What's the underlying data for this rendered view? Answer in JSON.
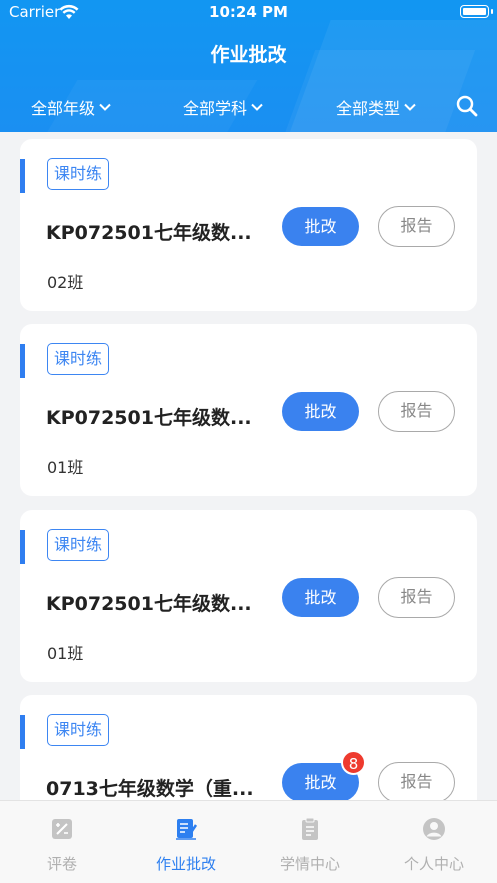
{
  "status_bar": {
    "carrier": "Carrier",
    "time": "10:24 PM"
  },
  "header": {
    "title": "作业批改",
    "filters": [
      {
        "label": "全部年级"
      },
      {
        "label": "全部学科"
      },
      {
        "label": "全部类型"
      }
    ],
    "search_icon": "search-icon"
  },
  "cards": [
    {
      "tag": "课时练",
      "title": "KP072501七年级数...",
      "class": "02班",
      "grade_label": "批改",
      "report_label": "报告"
    },
    {
      "tag": "课时练",
      "title": "KP072501七年级数...",
      "class": "01班",
      "grade_label": "批改",
      "report_label": "报告"
    },
    {
      "tag": "课时练",
      "title": "KP072501七年级数...",
      "class": "01班",
      "grade_label": "批改",
      "report_label": "报告"
    },
    {
      "tag": "课时练",
      "title": "0713七年级数学（重...",
      "class": "",
      "grade_label": "批改",
      "report_label": "报告",
      "badge": "8"
    }
  ],
  "tabbar": {
    "tabs": [
      {
        "label": "评卷",
        "icon": "exam-paper-icon"
      },
      {
        "label": "作业批改",
        "icon": "homework-edit-icon",
        "active": true
      },
      {
        "label": "学情中心",
        "icon": "clipboard-icon"
      },
      {
        "label": "个人中心",
        "icon": "person-icon"
      }
    ]
  },
  "colors": {
    "primary": "#1a8ff2",
    "button": "#3a82ef",
    "badge": "#ee3a2e",
    "inactive": "#b0b0b0"
  }
}
